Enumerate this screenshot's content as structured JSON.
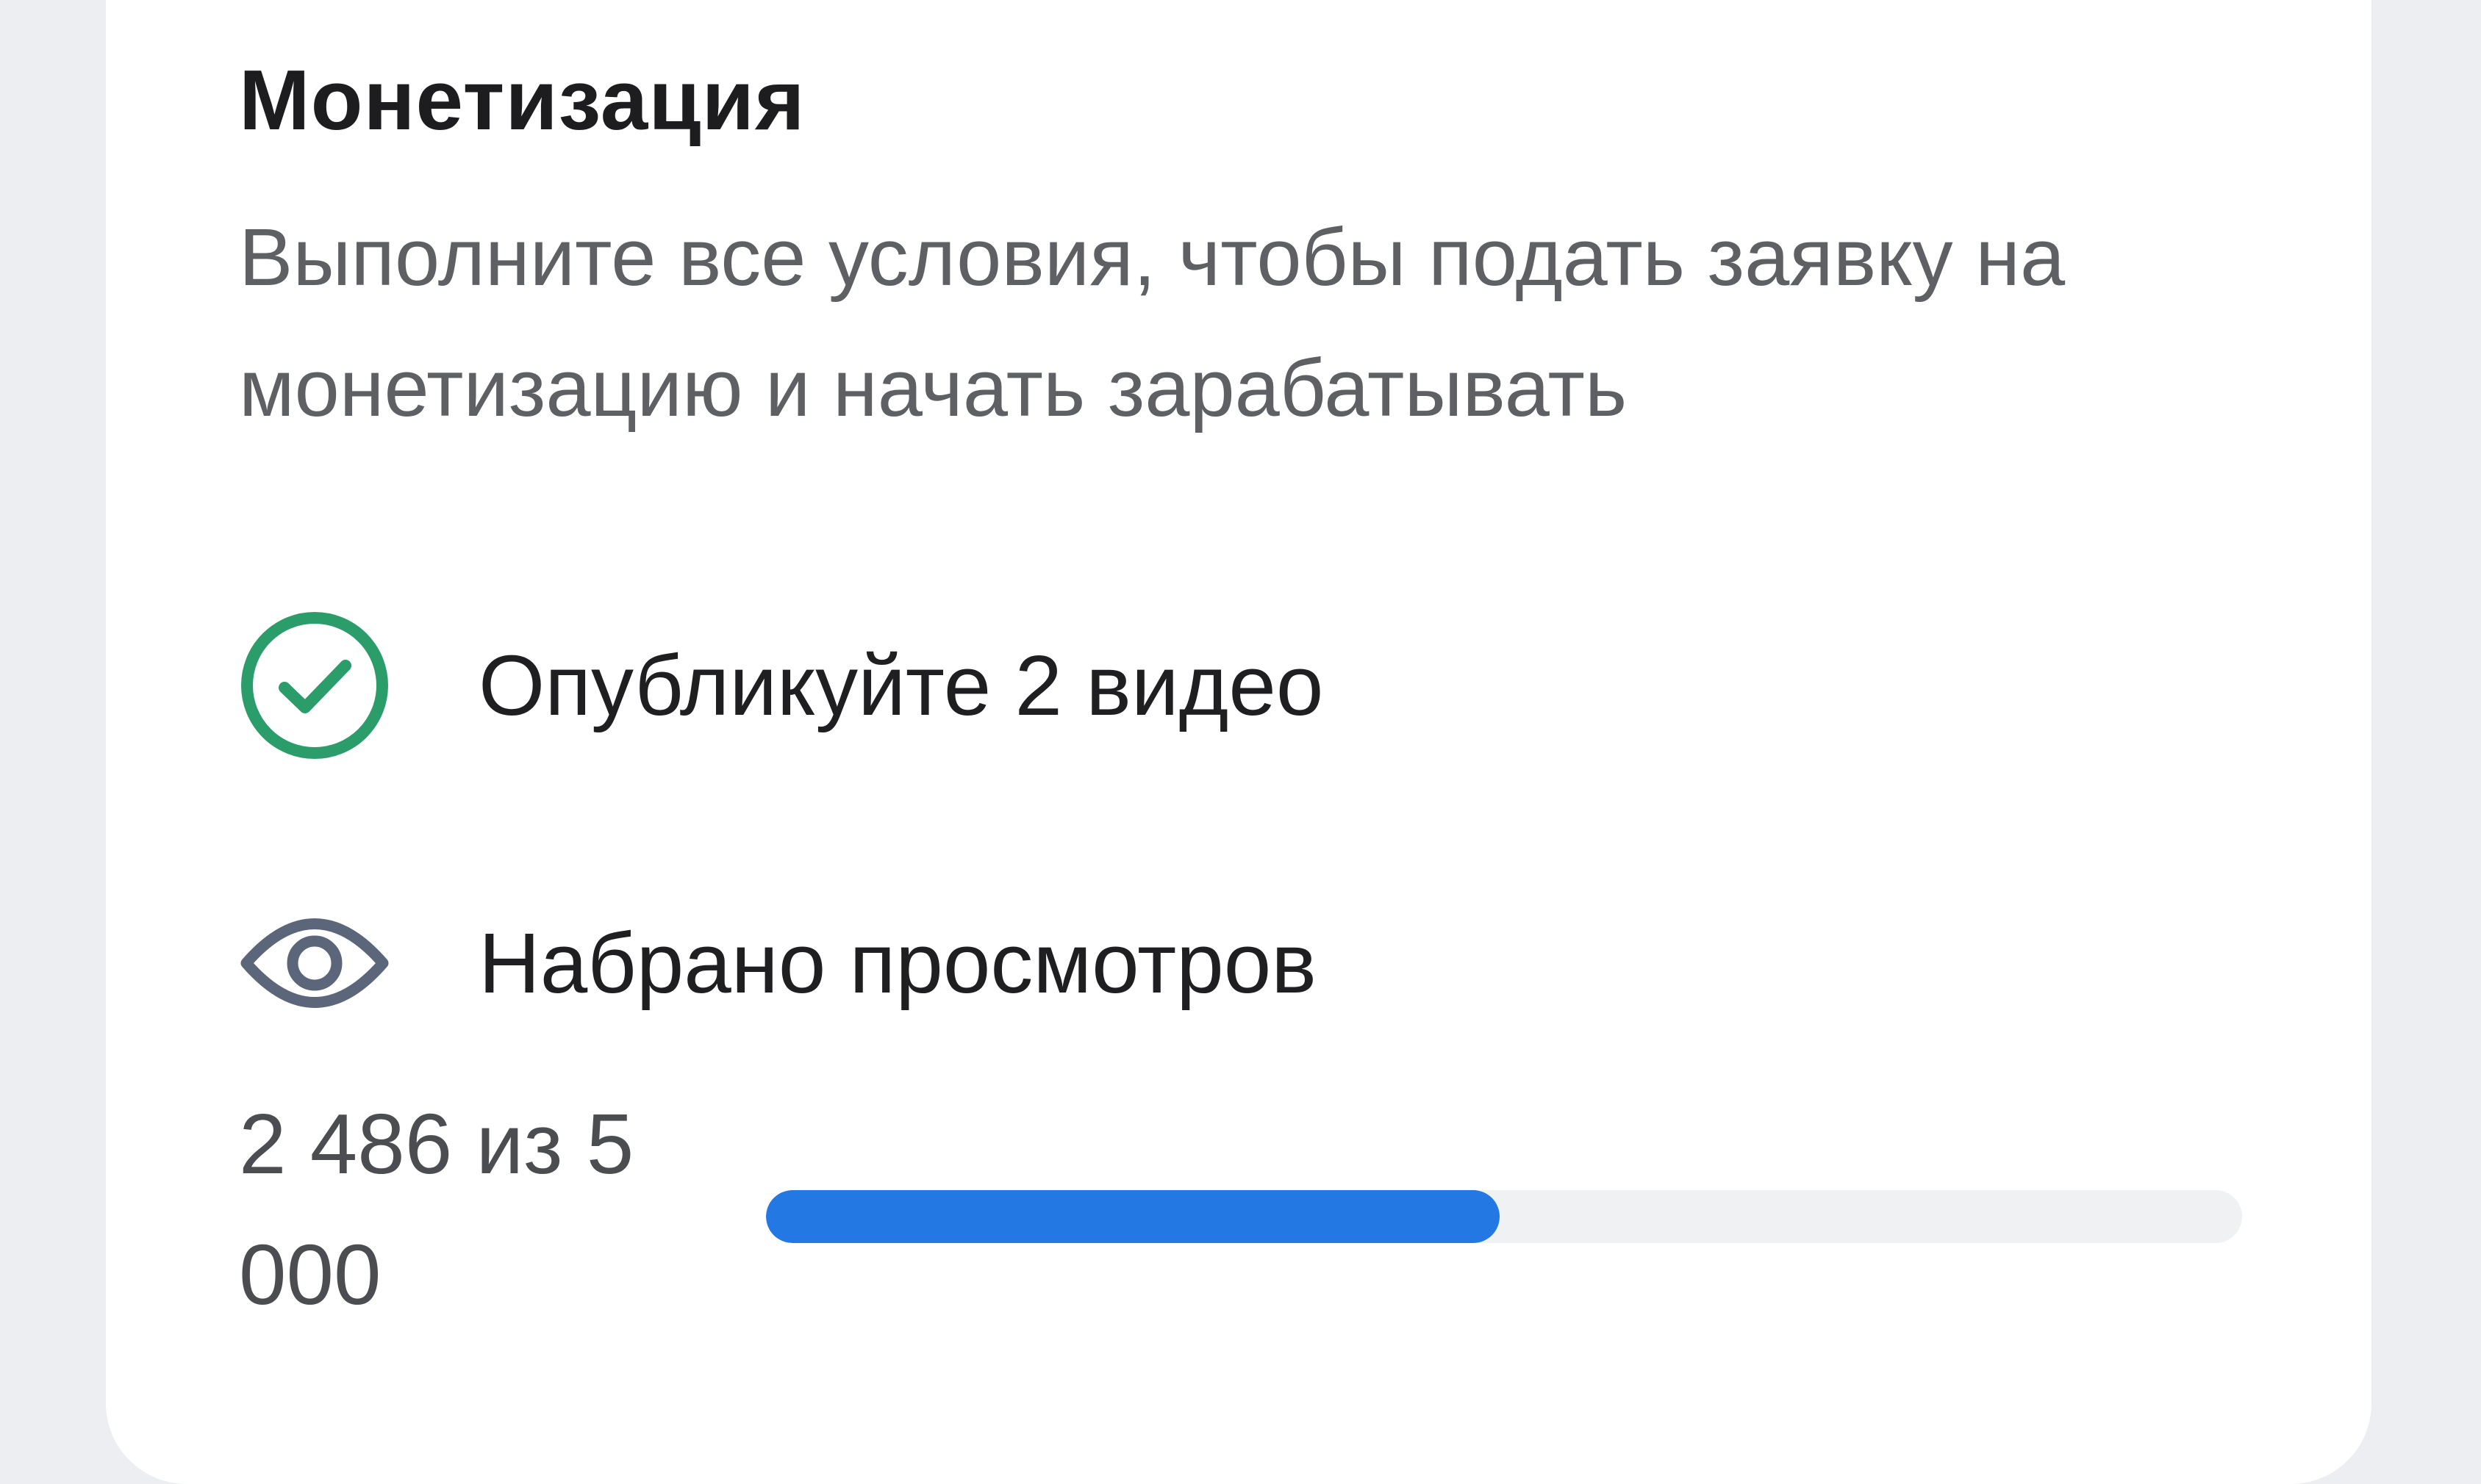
{
  "monetization": {
    "title": "Монетизация",
    "subtitle": "Выполните все условия, чтобы подать заявку на монетизацию и начать зарабатывать",
    "conditions": [
      {
        "icon": "check-circle-icon",
        "label": "Опубликуйте 2 видео",
        "completed": true
      },
      {
        "icon": "eye-icon",
        "label": "Набрано просмотров",
        "completed": false
      }
    ],
    "views_progress": {
      "text": "2 486 из 5 000",
      "current": 2486,
      "target": 5000,
      "fraction": 0.4972
    }
  },
  "colors": {
    "check_green": "#2a9d6a",
    "eye_gray": "#5c667a",
    "progress_blue": "#2478e3",
    "track_gray": "#f0f1f3"
  }
}
